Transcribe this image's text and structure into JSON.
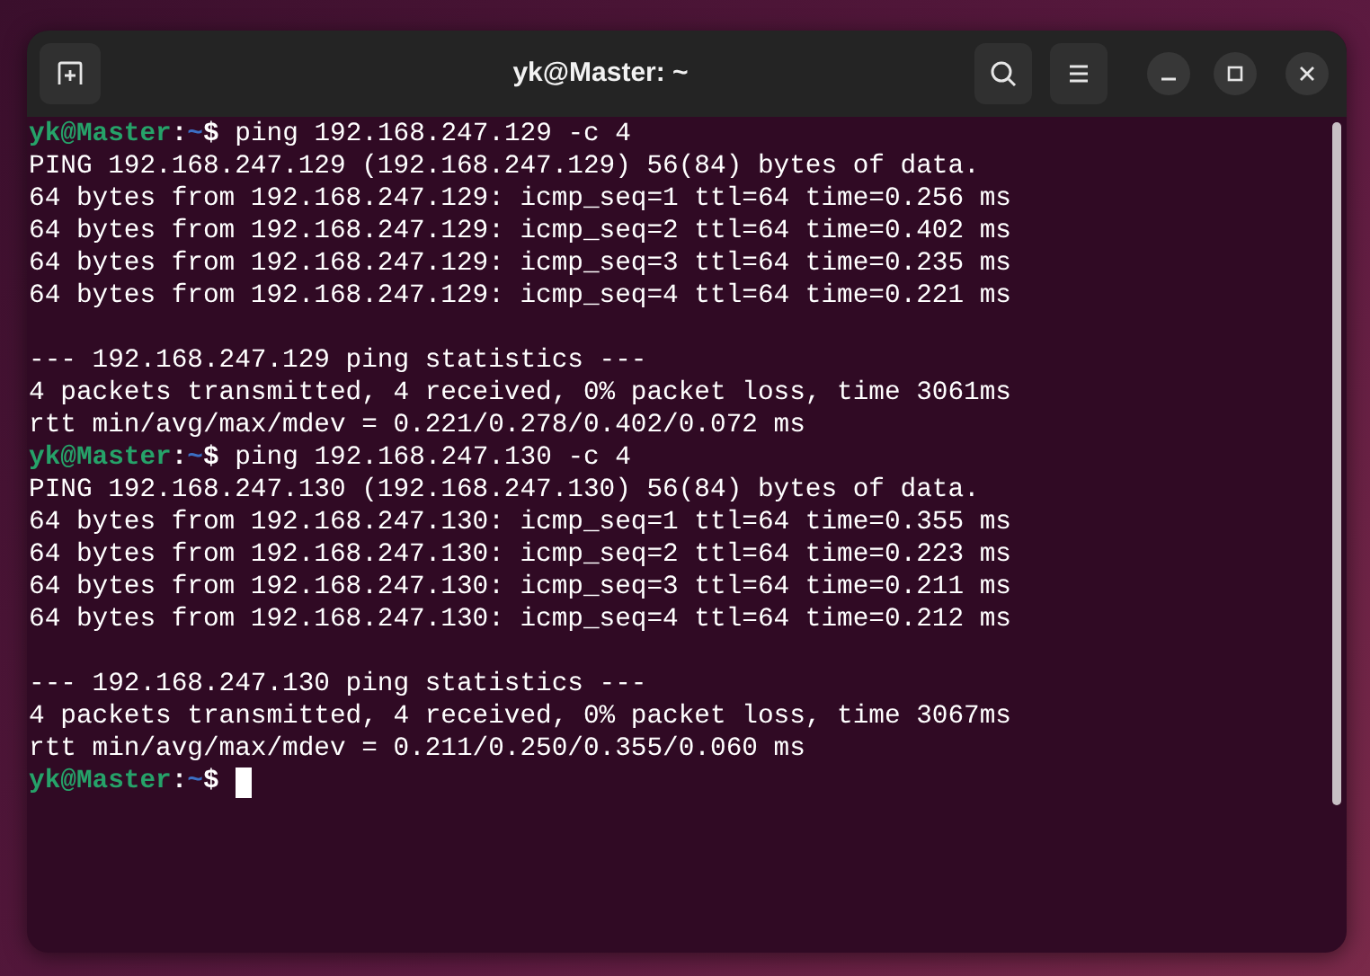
{
  "window": {
    "title": "yk@Master: ~"
  },
  "terminal": {
    "lines": [
      {
        "kind": "prompt",
        "user_host": "yk@Master",
        "separator": ":",
        "path": "~",
        "symbol": "$",
        "command": " ping 192.168.247.129 -c 4"
      },
      {
        "kind": "output",
        "text": "PING 192.168.247.129 (192.168.247.129) 56(84) bytes of data."
      },
      {
        "kind": "output",
        "text": "64 bytes from 192.168.247.129: icmp_seq=1 ttl=64 time=0.256 ms"
      },
      {
        "kind": "output",
        "text": "64 bytes from 192.168.247.129: icmp_seq=2 ttl=64 time=0.402 ms"
      },
      {
        "kind": "output",
        "text": "64 bytes from 192.168.247.129: icmp_seq=3 ttl=64 time=0.235 ms"
      },
      {
        "kind": "output",
        "text": "64 bytes from 192.168.247.129: icmp_seq=4 ttl=64 time=0.221 ms"
      },
      {
        "kind": "blank"
      },
      {
        "kind": "output",
        "text": "--- 192.168.247.129 ping statistics ---"
      },
      {
        "kind": "output",
        "text": "4 packets transmitted, 4 received, 0% packet loss, time 3061ms"
      },
      {
        "kind": "output",
        "text": "rtt min/avg/max/mdev = 0.221/0.278/0.402/0.072 ms"
      },
      {
        "kind": "prompt",
        "user_host": "yk@Master",
        "separator": ":",
        "path": "~",
        "symbol": "$",
        "command": " ping 192.168.247.130 -c 4"
      },
      {
        "kind": "output",
        "text": "PING 192.168.247.130 (192.168.247.130) 56(84) bytes of data."
      },
      {
        "kind": "output",
        "text": "64 bytes from 192.168.247.130: icmp_seq=1 ttl=64 time=0.355 ms"
      },
      {
        "kind": "output",
        "text": "64 bytes from 192.168.247.130: icmp_seq=2 ttl=64 time=0.223 ms"
      },
      {
        "kind": "output",
        "text": "64 bytes from 192.168.247.130: icmp_seq=3 ttl=64 time=0.211 ms"
      },
      {
        "kind": "output",
        "text": "64 bytes from 192.168.247.130: icmp_seq=4 ttl=64 time=0.212 ms"
      },
      {
        "kind": "blank"
      },
      {
        "kind": "output",
        "text": "--- 192.168.247.130 ping statistics ---"
      },
      {
        "kind": "output",
        "text": "4 packets transmitted, 4 received, 0% packet loss, time 3067ms"
      },
      {
        "kind": "output",
        "text": "rtt min/avg/max/mdev = 0.211/0.250/0.355/0.060 ms"
      },
      {
        "kind": "prompt",
        "user_host": "yk@Master",
        "separator": ":",
        "path": "~",
        "symbol": "$",
        "cursor": true
      }
    ]
  }
}
